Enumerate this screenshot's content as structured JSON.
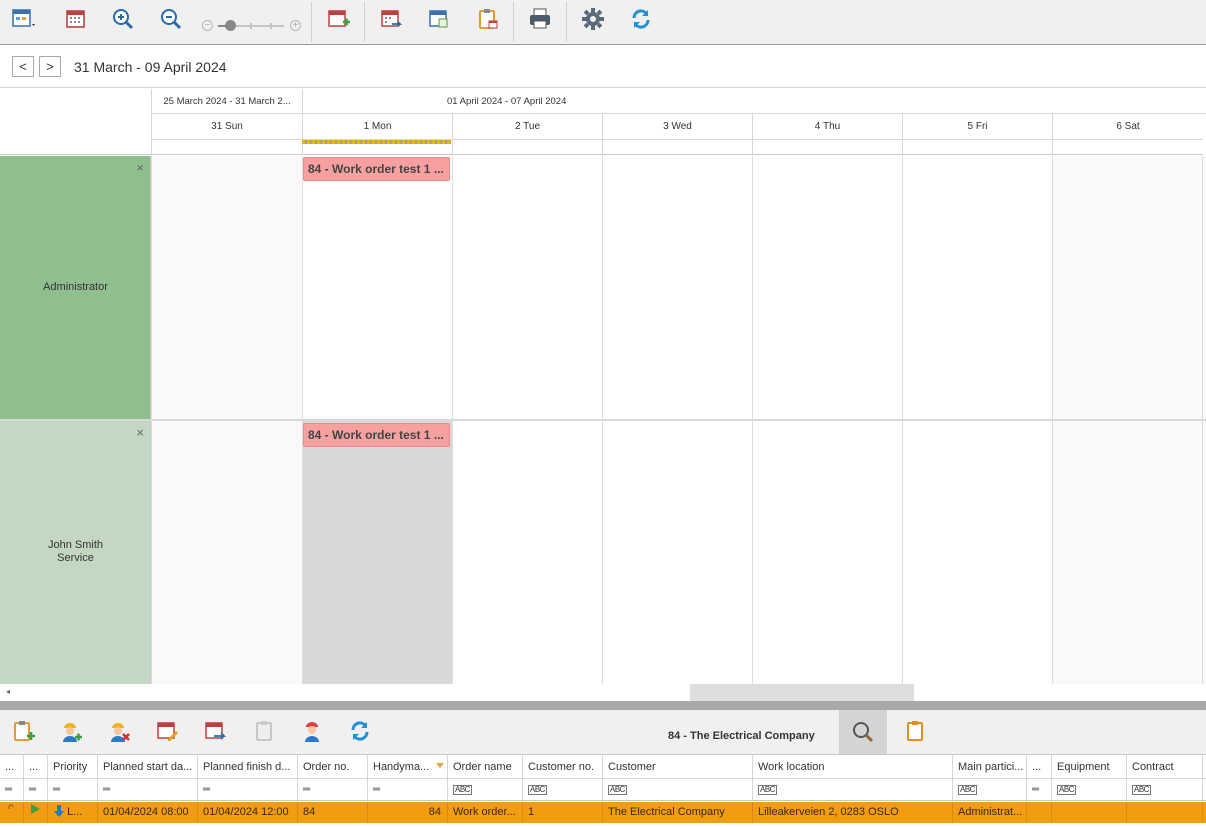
{
  "toolbar": {
    "icons": [
      "calendar-view-icon",
      "calendar-icon",
      "zoom-in-icon",
      "zoom-out-icon",
      "zoom-slider",
      "new-appointment-icon",
      "export-calendar-icon",
      "calendar-day-icon",
      "clipboard-calendar-icon",
      "print-icon",
      "settings-icon",
      "refresh-icon"
    ],
    "slider_minus": "−",
    "slider_plus": "+"
  },
  "nav": {
    "prev": "<",
    "next": ">",
    "range": "31 March - 09 April 2024"
  },
  "scheduler": {
    "weeks": [
      "25 March 2024 - 31 March 2...",
      "01 April 2024 - 07 April 2024"
    ],
    "days": [
      "31 Sun",
      "1 Mon",
      "2 Tue",
      "3 Wed",
      "4 Thu",
      "5 Fri",
      "6 Sat"
    ],
    "resources": [
      {
        "name": "Administrator",
        "close": "×",
        "color": "#8fbf8f"
      },
      {
        "name": "John Smith",
        "name2": "Service",
        "close": "×",
        "color": "#c3d7c3"
      }
    ],
    "appointments": [
      {
        "label": "84 - Work order test 1 ...",
        "color": "#f6a0a0"
      },
      {
        "label": "84 - Work order test 1 ..."
      }
    ],
    "scroll_left": "◂"
  },
  "bottom_toolbar": {
    "company": "84 - The Electrical Company"
  },
  "grid": {
    "columns": [
      "...",
      "...",
      "Priority",
      "Planned start da...",
      "Planned finish d...",
      "Order no.",
      "Handyma...",
      "Order name",
      "Customer no.",
      "Customer",
      "Work location",
      "Main partici...",
      "...",
      "Equipment",
      "Contract"
    ],
    "filter_eq": "═",
    "filter_abc": "ABC",
    "row": {
      "priority": "L...",
      "start": "01/04/2024 08:00",
      "finish": "01/04/2024 12:00",
      "order_no": "84",
      "handyman": "84",
      "order_name": "Work order...",
      "customer_no": "1",
      "customer": "The Electrical Company",
      "work_location": "Lilleakerveien 2, 0283 OSLO",
      "main_participant": "Administrat..."
    },
    "row_color": "#f39c12"
  }
}
